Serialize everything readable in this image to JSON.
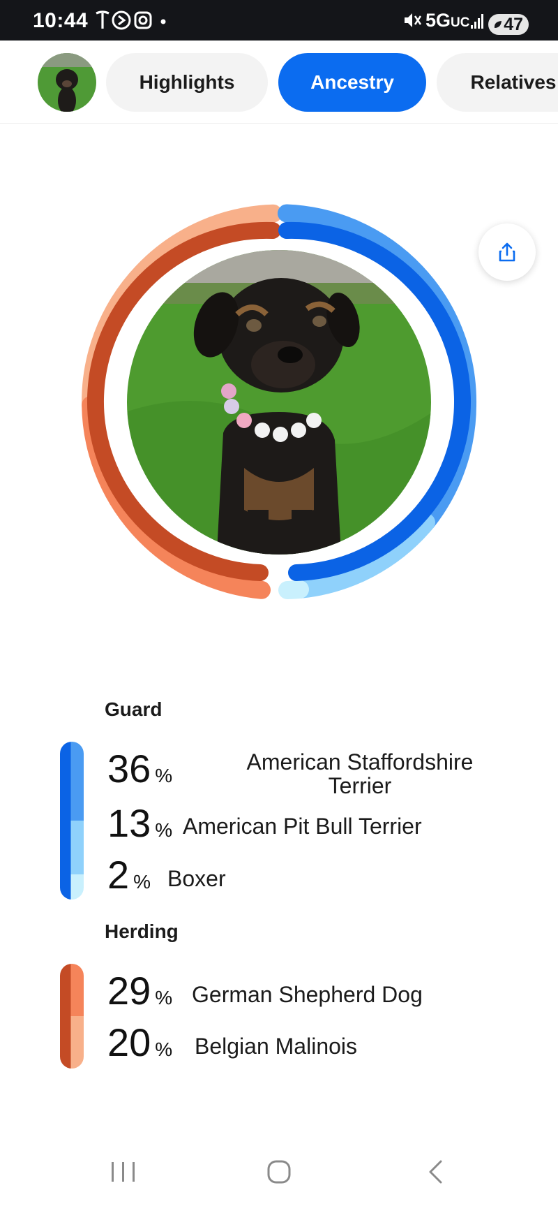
{
  "status_bar": {
    "time": "10:44",
    "network": "5G",
    "network_sub": "UC",
    "battery": "47"
  },
  "tabs": [
    {
      "label": "Highlights",
      "active": false
    },
    {
      "label": "Ancestry",
      "active": true
    },
    {
      "label": "Relatives",
      "active": false
    }
  ],
  "colors": {
    "accent": "#0b6cf0",
    "guard_dark": "#0b63e5",
    "guard_mid": "#4a9bf2",
    "guard_light": "#8fd1fb",
    "guard_pale": "#c9f0fd",
    "herding_dark": "#c44b25",
    "herding_mid": "#f5845a",
    "herding_light": "#f8b08a"
  },
  "ancestry": {
    "groups": [
      {
        "name": "Guard",
        "breeds": [
          {
            "percent": "36",
            "sign": "%",
            "name_line1": "American Staffordshire",
            "name_line2": "Terrier"
          },
          {
            "percent": "13",
            "sign": "%",
            "name": "American Pit Bull Terrier"
          },
          {
            "percent": "2",
            "sign": "%",
            "name": "Boxer"
          }
        ]
      },
      {
        "name": "Herding",
        "breeds": [
          {
            "percent": "29",
            "sign": "%",
            "name": "German Shepherd Dog"
          },
          {
            "percent": "20",
            "sign": "%",
            "name": "Belgian Malinois"
          }
        ]
      }
    ]
  },
  "icons": {
    "share": "share-icon",
    "nav_recent": "recent-apps-icon",
    "nav_home": "home-icon",
    "nav_back": "back-icon"
  }
}
